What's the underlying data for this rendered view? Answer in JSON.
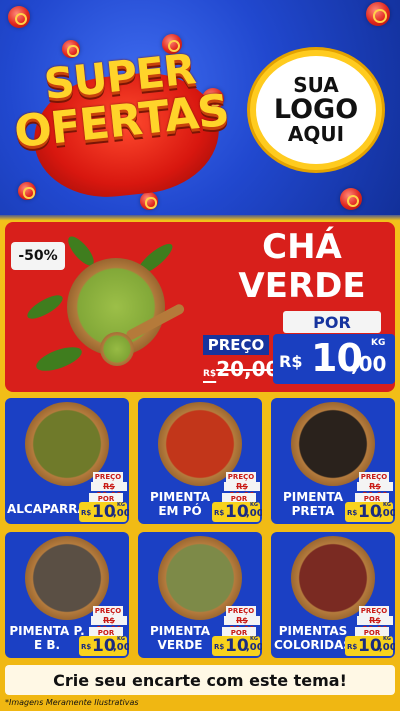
{
  "hero": {
    "title_line1": "SUPER",
    "title_line2": "OFERTAS",
    "logo_line1": "SUA",
    "logo_line2": "LOGO",
    "logo_line3": "AQUI"
  },
  "feature": {
    "discount": "-50%",
    "name_line1": "CHÁ",
    "name_line2": "VERDE",
    "por_label": "POR",
    "preco_label": "PREÇO",
    "old_currency": "R$",
    "old_price": "20,00",
    "currency": "R$",
    "price_int": "10",
    "price_dec": ",00",
    "unit": "KG",
    "image_icon": "green-tea-powder-bowl"
  },
  "products": [
    {
      "name": "ALCAPARRAS",
      "preco_label": "PREÇO",
      "old_price": "R$ 20,00",
      "por_label": "POR",
      "currency": "R$",
      "price_int": "10",
      "price_dec": ",00",
      "unit": "KG",
      "color": "#6f7a2a",
      "image_icon": "capers-bowl"
    },
    {
      "name": "PIMENTA EM PÓ",
      "preco_label": "PREÇO",
      "old_price": "R$ 20,00",
      "por_label": "POR",
      "currency": "R$",
      "price_int": "10",
      "price_dec": ",00",
      "unit": "KG",
      "color": "#c2361a",
      "image_icon": "pepper-powder-bowl"
    },
    {
      "name": "PIMENTA PRETA",
      "preco_label": "PREÇO",
      "old_price": "R$ 20,00",
      "por_label": "POR",
      "currency": "R$",
      "price_int": "10",
      "price_dec": ",00",
      "unit": "KG",
      "color": "#2a221c",
      "image_icon": "black-pepper-bowl"
    },
    {
      "name": "PIMENTA P. E B.",
      "preco_label": "PREÇO",
      "old_price": "R$ 20,00",
      "por_label": "POR",
      "currency": "R$",
      "price_int": "10",
      "price_dec": ",00",
      "unit": "KG",
      "color": "#5a4f44",
      "image_icon": "black-white-pepper-bowl"
    },
    {
      "name": "PIMENTA VERDE",
      "preco_label": "PREÇO",
      "old_price": "R$ 20,00",
      "por_label": "POR",
      "currency": "R$",
      "price_int": "10",
      "price_dec": ",00",
      "unit": "KG",
      "color": "#7d8a48",
      "image_icon": "green-pepper-bowl"
    },
    {
      "name": "PIMENTAS COLORIDAS",
      "preco_label": "PREÇO",
      "old_price": "R$ 20,00",
      "por_label": "POR",
      "currency": "R$",
      "price_int": "10",
      "price_dec": ",00",
      "unit": "KG",
      "color": "#7a2a22",
      "image_icon": "mixed-pepper-bowl"
    }
  ],
  "cta": "Crie seu encarte com este tema!",
  "disclaimer": "*Imagens Meramente Ilustrativas",
  "colors": {
    "blue": "#1b40c4",
    "red": "#d81f1b",
    "yellow": "#f3c21a"
  }
}
